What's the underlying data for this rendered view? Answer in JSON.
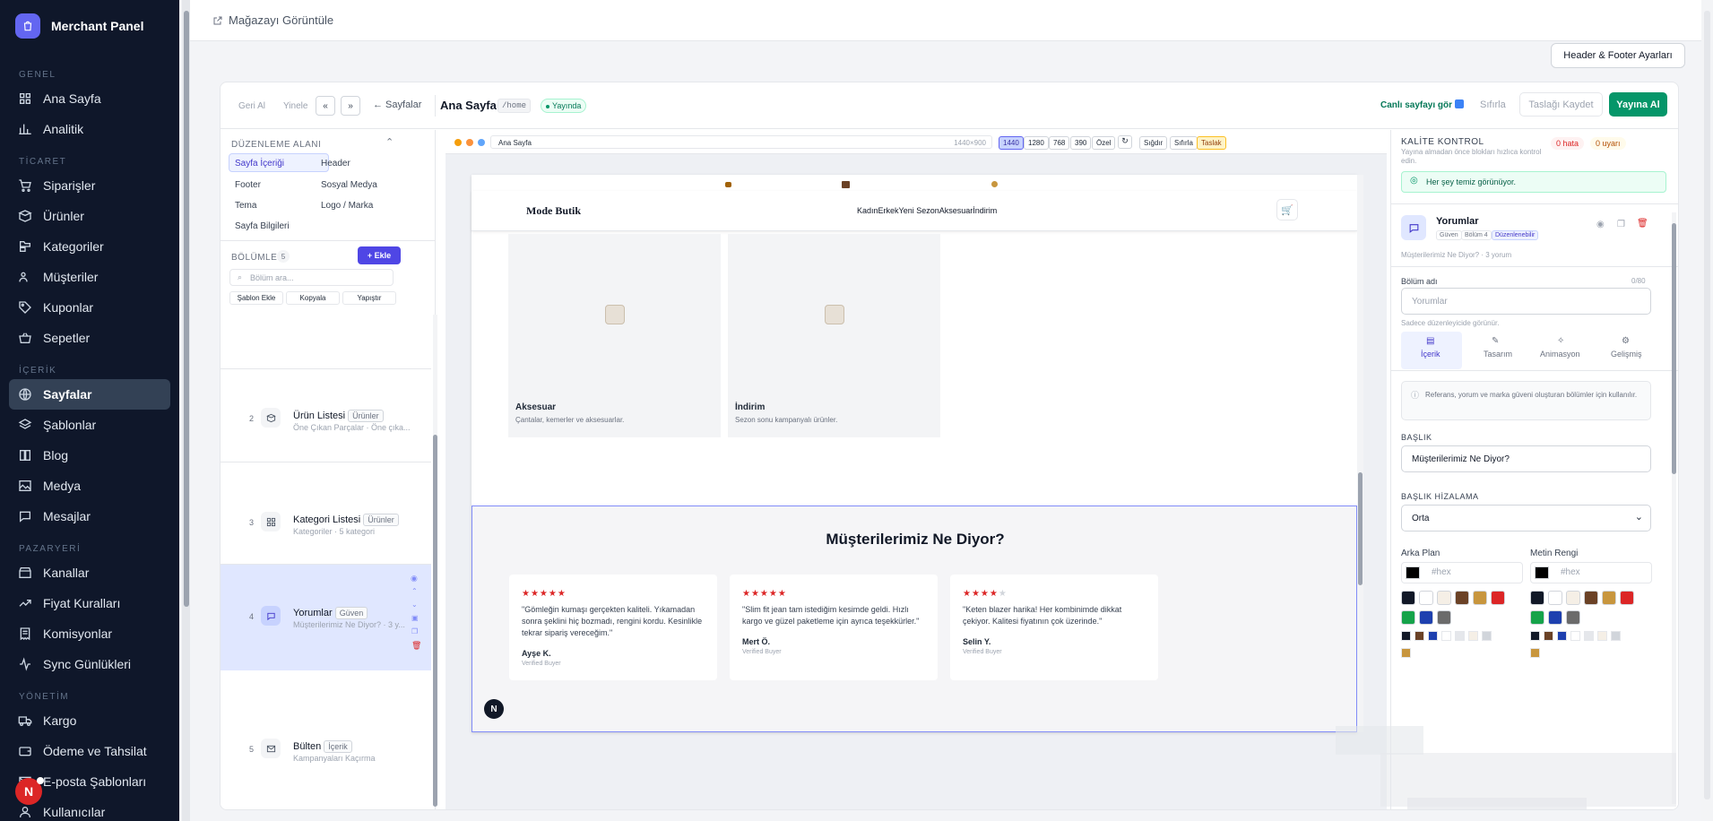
{
  "sidebar": {
    "brand": "Merchant Panel",
    "sections": [
      {
        "title": "GENEL",
        "items": [
          {
            "label": "Ana Sayfa",
            "icon": "grid-icon"
          },
          {
            "label": "Analitik",
            "icon": "bar-chart-icon"
          }
        ]
      },
      {
        "title": "TİCARET",
        "items": [
          {
            "label": "Siparişler",
            "icon": "cart-icon"
          },
          {
            "label": "Ürünler",
            "icon": "box-icon"
          },
          {
            "label": "Kategoriler",
            "icon": "folder-tree-icon"
          },
          {
            "label": "Müşteriler",
            "icon": "users-icon"
          },
          {
            "label": "Kuponlar",
            "icon": "tag-icon"
          },
          {
            "label": "Sepetler",
            "icon": "basket-icon"
          }
        ]
      },
      {
        "title": "İÇERİK",
        "items": [
          {
            "label": "Sayfalar",
            "icon": "globe-icon",
            "active": true
          },
          {
            "label": "Şablonlar",
            "icon": "layers-icon"
          },
          {
            "label": "Blog",
            "icon": "book-icon"
          },
          {
            "label": "Medya",
            "icon": "image-icon"
          },
          {
            "label": "Mesajlar",
            "icon": "message-icon"
          }
        ]
      },
      {
        "title": "PAZARYERİ",
        "items": [
          {
            "label": "Kanallar",
            "icon": "store-icon"
          },
          {
            "label": "Fiyat Kuralları",
            "icon": "trend-icon"
          },
          {
            "label": "Komisyonlar",
            "icon": "receipt-icon"
          },
          {
            "label": "Sync Günlükleri",
            "icon": "activity-icon"
          }
        ]
      },
      {
        "title": "YÖNETİM",
        "items": [
          {
            "label": "Kargo",
            "icon": "truck-icon"
          },
          {
            "label": "Ödeme ve Tahsilat",
            "icon": "wallet-icon"
          },
          {
            "label": "E-posta Şablonları",
            "icon": "mail-icon"
          },
          {
            "label": "Kullanıcılar",
            "icon": "user-icon"
          }
        ]
      }
    ],
    "avatar": "N"
  },
  "topbar": {
    "store_link": "Mağazayı Görüntüle",
    "hf_button": "Header & Footer Ayarları"
  },
  "toolbar": {
    "undo": "Geri Al",
    "redo": "Yinele",
    "collapse_left": "«",
    "collapse_right": "»",
    "back": "← Sayfalar",
    "page_title": "Ana Sayfa",
    "slug": "/home",
    "status": "Yayında",
    "live_link": "Canlı sayfayı gör",
    "reset": "Sıfırla",
    "save_draft": "Taslağı Kaydet",
    "publish": "Yayına Al"
  },
  "edit_area": {
    "title": "DÜZENLEME ALANI",
    "items": [
      "Sayfa İçeriği",
      "Header",
      "Footer",
      "Sosyal Medya",
      "Tema",
      "Logo / Marka",
      "Sayfa Bilgileri"
    ]
  },
  "sections": {
    "title": "BÖLÜMLER",
    "count": "5",
    "add": "+ Ekle",
    "search_placeholder": "Bölüm ara...",
    "actions": [
      "Şablon Ekle",
      "Kopyala",
      "Yapıştır"
    ],
    "items": [
      {
        "num": "2",
        "title": "Ürün Listesi",
        "badge": "Ürünler",
        "sub": "Öne Çıkan Parçalar · Öne çıka...",
        "icon": "box-icon"
      },
      {
        "num": "3",
        "title": "Kategori Listesi",
        "badge": "Ürünler",
        "sub": "Kategoriler · 5 kategori",
        "icon": "grid-icon"
      },
      {
        "num": "4",
        "title": "Yorumlar",
        "badge": "Güven",
        "sub": "Müşterilerimiz Ne Diyor? · 3 y...",
        "icon": "message-icon"
      },
      {
        "num": "5",
        "title": "Bülten",
        "badge": "İçerik",
        "sub": "Kampanyaları Kaçırma",
        "icon": "mail-icon"
      }
    ]
  },
  "canvas": {
    "url": "Ana Sayfa",
    "dims": "1440×900",
    "viewports": [
      "1440",
      "1280",
      "768",
      "390",
      "Özel"
    ],
    "fit": "Sığdır",
    "reset": "Sıfırla",
    "draft": "Taslak",
    "site": {
      "logo": "Mode Butik",
      "nav": "KadınErkekYeni SezonAksesuarİndirim",
      "categories": [
        {
          "title": "Aksesuar",
          "desc": "Çantalar, kemerler ve aksesuarlar."
        },
        {
          "title": "İndirim",
          "desc": "Sezon sonu kampanyalı ürünler."
        }
      ],
      "reviews_title": "Müşterilerimiz Ne Diyor?",
      "reviews": [
        {
          "stars": "★★★★★",
          "text": "\"Gömleğin kumaşı gerçekten kaliteli. Yıkamadan sonra şeklini hiç bozmadı, rengini kordu. Kesinlikle tekrar sipariş vereceğim.\"",
          "name": "Ayşe K.",
          "role": "Verified Buyer",
          "rating": 5
        },
        {
          "stars": "★★★★★",
          "text": "\"Slim fit jean tam istediğim kesimde geldi. Hızlı kargo ve güzel paketleme için ayrıca teşekkürler.\"",
          "name": "Mert Ö.",
          "role": "Verified Buyer",
          "rating": 5
        },
        {
          "stars": "★★★★",
          "star_empty": "★",
          "text": "\"Keten blazer harika! Her kombinimde dikkat çekiyor. Kalitesi fiyatının çok üzerinde.\"",
          "name": "Selin Y.",
          "role": "Verified Buyer",
          "rating": 4
        }
      ]
    }
  },
  "quality": {
    "title": "KALİTE KONTROL",
    "desc": "Yayına almadan önce blokları hızlıca kontrol edin.",
    "errors": "0 hata",
    "warnings": "0 uyarı",
    "ok": "Her şey temiz görünüyor."
  },
  "inspector": {
    "title": "Yorumlar",
    "badges": [
      "Güven",
      "Bölüm 4",
      "Düzenlenebilir"
    ],
    "sub": "Müşterilerimiz Ne Diyor? · 3 yorum",
    "name_label": "Bölüm adı",
    "name_count": "0/80",
    "name_placeholder": "Yorumlar",
    "name_hint": "Sadece düzenleyicide görünür.",
    "tabs": [
      "İçerik",
      "Tasarım",
      "Animasyon",
      "Gelişmiş"
    ],
    "info": "Referans, yorum ve marka güveni oluşturan bölümler için kullanılır.",
    "heading_label": "BAŞLIK",
    "heading_value": "Müşterilerimiz Ne Diyor?",
    "align_label": "BAŞLIK HİZALAMA",
    "align_value": "Orta",
    "bg_label": "Arka Plan",
    "text_label": "Metin Rengi",
    "hex_placeholder": "#hex",
    "swatches1": [
      "#111827",
      "#ffffff",
      "#f5efe6",
      "#6b4226",
      "#c8963e",
      "#dc2626",
      "#16a34a",
      "#1e40af",
      "#6b6b6b"
    ],
    "swatches2": [
      "#111827",
      "#6b4226",
      "#1e40af",
      "#ffffff",
      "#e5e7eb",
      "#f5efe6",
      "#d1d5db",
      "#c8963e"
    ]
  },
  "colors": {
    "accent": "#4f46e5",
    "publish": "#059669",
    "danger": "#dc2626",
    "sidebar": "#0f172a"
  }
}
